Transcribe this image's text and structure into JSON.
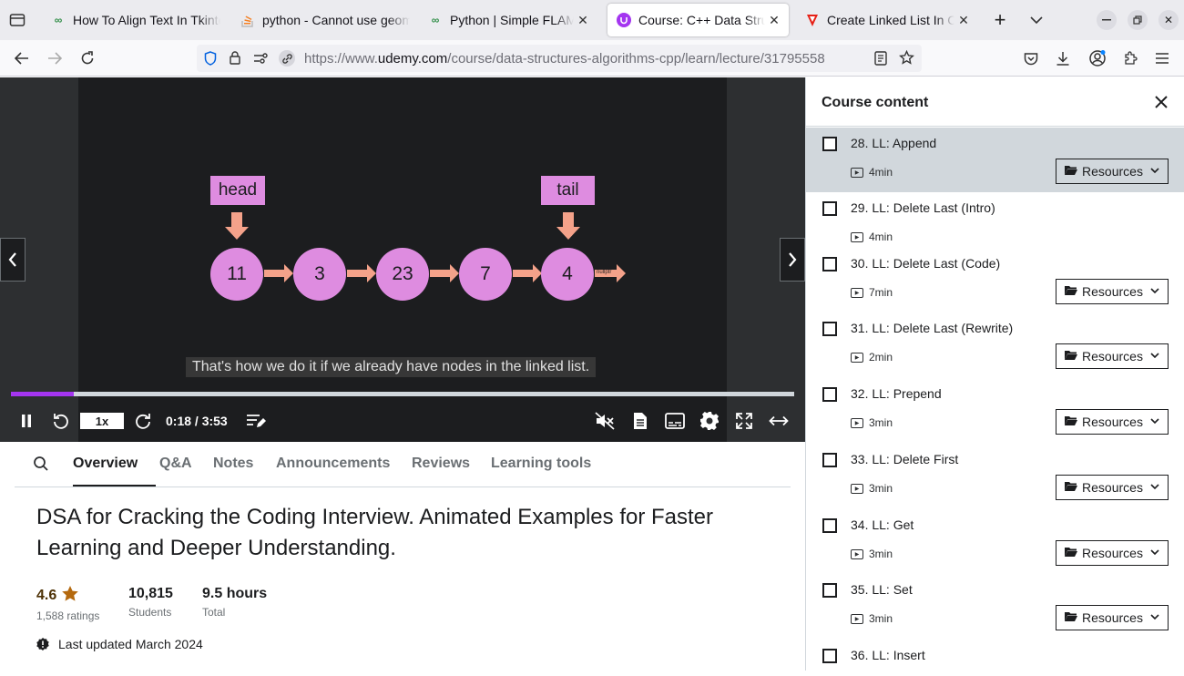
{
  "browser": {
    "tabs": [
      {
        "title": "How To Align Text In Tkinter Label",
        "favicon": "geeksforgeeks-icon"
      },
      {
        "title": "python - Cannot use geometry manager",
        "favicon": "stackoverflow-icon"
      },
      {
        "title": "Python | Simple FLAMES game",
        "favicon": "geeksforgeeks-icon"
      },
      {
        "title": "Course: C++ Data Structures",
        "favicon": "udemy-icon"
      },
      {
        "title": "Create Linked List In C++",
        "favicon": "youtube-red-icon"
      }
    ],
    "url": {
      "prefix": "https://www.",
      "domain": "udemy.com",
      "path": "/course/data-structures-algorithms-cpp/learn/lecture/31795558"
    }
  },
  "video": {
    "slide": {
      "head_label": "head",
      "tail_label": "tail",
      "nodes": [
        "11",
        "3",
        "23",
        "7",
        "4"
      ],
      "nullptr_label": "nullptr"
    },
    "caption": "That's how we do it if we already have nodes in the linked list.",
    "progress_fraction": 0.08,
    "speed": "1x",
    "time": "0:18 / 3:53"
  },
  "course_tabs": [
    "Overview",
    "Q&A",
    "Notes",
    "Announcements",
    "Reviews",
    "Learning tools"
  ],
  "course": {
    "title": "DSA for Cracking the Coding Interview. Animated Examples for Faster Learning and Deeper Understanding.",
    "rating": "4.6",
    "ratings_count": "1,588 ratings",
    "students": "10,815",
    "students_label": "Students",
    "hours": "9.5 hours",
    "hours_label": "Total",
    "last_updated": "Last updated March 2024"
  },
  "sidebar": {
    "title": "Course content",
    "resources_label": "Resources",
    "lectures": [
      {
        "title": "28. LL: Append",
        "duration": "4min",
        "resources": true,
        "active": true
      },
      {
        "title": "29. LL: Delete Last (Intro)",
        "duration": "4min",
        "resources": false
      },
      {
        "title": "30. LL: Delete Last (Code)",
        "duration": "7min",
        "resources": true
      },
      {
        "title": "31. LL: Delete Last (Rewrite)",
        "duration": "2min",
        "resources": true
      },
      {
        "title": "32. LL: Prepend",
        "duration": "3min",
        "resources": true
      },
      {
        "title": "33. LL: Delete First",
        "duration": "3min",
        "resources": true
      },
      {
        "title": "34. LL: Get",
        "duration": "3min",
        "resources": true
      },
      {
        "title": "35. LL: Set",
        "duration": "3min",
        "resources": true
      },
      {
        "title": "36. LL: Insert",
        "duration": "",
        "resources": false
      }
    ]
  },
  "colors": {
    "accent": "#a435f0",
    "node": "#de8ce0",
    "arrow": "#f4a28a",
    "star": "#b4690e"
  }
}
